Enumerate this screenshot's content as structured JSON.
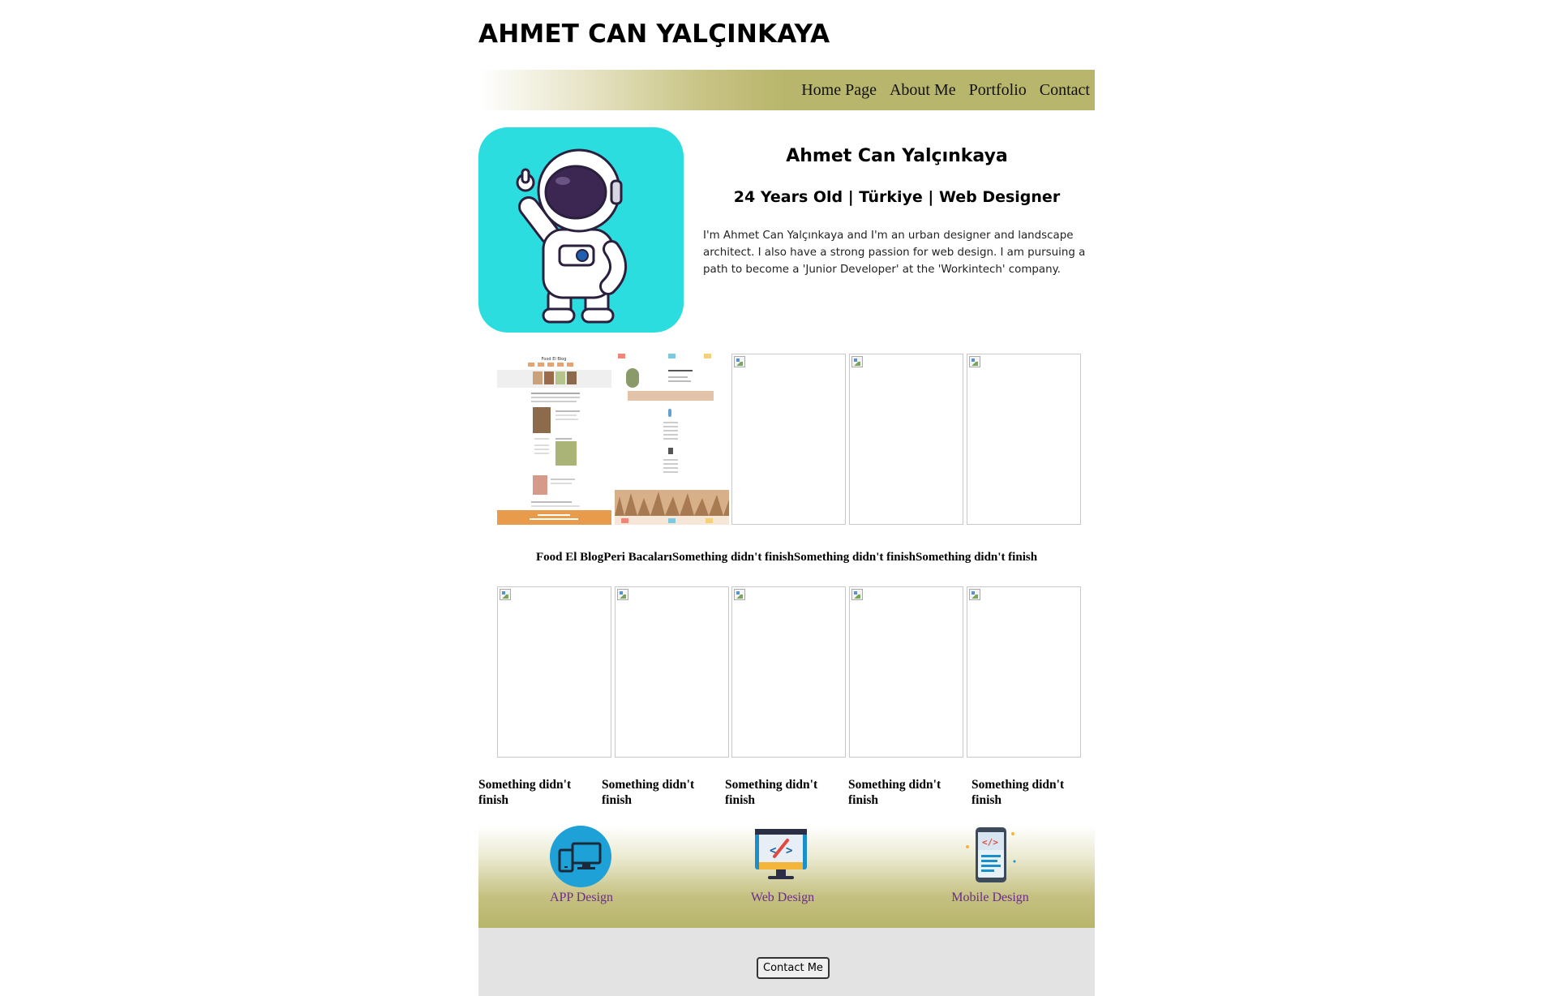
{
  "header": {
    "title": "AHMET CAN YALÇINKAYA"
  },
  "nav": {
    "items": [
      "Home Page",
      "About Me",
      "Portfolio",
      "Contact"
    ]
  },
  "profile": {
    "name": "Ahmet Can Yalçınkaya",
    "subtitle": "24 Years Old | Türkiye | Web Designer",
    "bio": "I'm Ahmet Can Yalçınkaya and I'm an urban designer and landscape architect. I also have a strong passion for web design. I am pursuing a path to become a 'Junior Developer' at the 'Workintech' company."
  },
  "portfolio_row1": {
    "captions": [
      "Food El Blog",
      "Peri Bacaları",
      "Something didn't finish",
      "Something didn't finish",
      "Something didn't finish"
    ]
  },
  "portfolio_row2": {
    "captions": [
      "Something didn't finish",
      "Something didn't finish",
      "Something didn't finish",
      "Something didn't finish",
      "Something didn't finish"
    ]
  },
  "mockup_food": {
    "title": "Food El Blog"
  },
  "services": {
    "items": [
      {
        "label": "APP Design",
        "icon": "devices-icon"
      },
      {
        "label": "Web Design",
        "icon": "web-design-icon"
      },
      {
        "label": "Mobile Design",
        "icon": "mobile-code-icon"
      }
    ]
  },
  "footer": {
    "contact_label": "Contact Me"
  },
  "colors": {
    "accent_olive": "#b8b56c",
    "avatar_bg": "#2cdde0",
    "service_link": "#6b2c8a",
    "footer_bg": "#e3e3e3"
  }
}
